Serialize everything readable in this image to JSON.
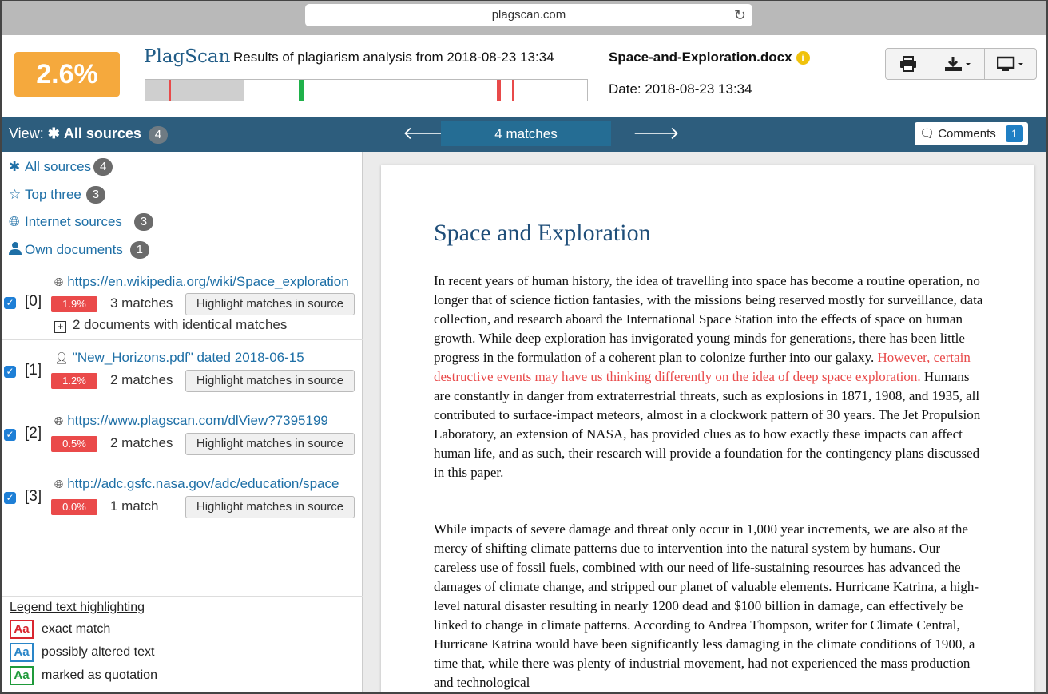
{
  "browser": {
    "url": "plagscan.com"
  },
  "header": {
    "score": "2.6%",
    "logo": "PlagScan",
    "analysis_title": "Results of plagiarism analysis from 2018-08-23 13:34",
    "doc_name": "Space-and-Exploration.docx",
    "doc_date": "Date: 2018-08-23 13:34",
    "colors": {
      "score": "#f5a93d",
      "brand": "#1f5b86",
      "bar_red": "#e84a4a",
      "bar_green": "#1fb14a"
    }
  },
  "toolbar": {
    "view_prefix": "View:",
    "view_value": "All sources",
    "view_count": "4",
    "matches": "4 matches",
    "comments_label": "Comments",
    "comments_count": "1"
  },
  "filters": [
    {
      "label": "All sources",
      "count": "4",
      "icon": "asterisk-icon"
    },
    {
      "label": "Top three",
      "count": "3",
      "icon": "star-icon"
    },
    {
      "label": "Internet sources",
      "count": "3",
      "icon": "globe-icon"
    },
    {
      "label": "Own documents",
      "count": "1",
      "icon": "user-icon"
    }
  ],
  "sources": [
    {
      "index": "[0]",
      "link": "https://en.wikipedia.org/wiki/Space_exploration",
      "percent": "1.9%",
      "matches": "3 matches",
      "button": "Highlight matches in source",
      "extra": "2 documents with identical matches",
      "icon": "globe-icon"
    },
    {
      "index": "[1]",
      "link": "\"New_Horizons.pdf\" dated 2018-06-15",
      "percent": "1.2%",
      "matches": "2 matches",
      "button": "Highlight matches in source",
      "icon": "user-icon"
    },
    {
      "index": "[2]",
      "link": "https://www.plagscan.com/dlView?7395199",
      "percent": "0.5%",
      "matches": "2 matches",
      "button": "Highlight matches in source",
      "icon": "globe-icon"
    },
    {
      "index": "[3]",
      "link": "http://adc.gsfc.nasa.gov/adc/education/space",
      "percent": "0.0%",
      "matches": "1 match",
      "button": "Highlight matches in source",
      "icon": "globe-icon"
    }
  ],
  "legend": {
    "title": "Legend text highlighting",
    "items": [
      {
        "sample": "Aa",
        "label": "exact match",
        "color": "#d9262f"
      },
      {
        "sample": "Aa",
        "label": "possibly altered text",
        "color": "#2a86c8"
      },
      {
        "sample": "Aa",
        "label": "marked as quotation",
        "color": "#1f9a3a"
      }
    ]
  },
  "document": {
    "title": "Space and Exploration",
    "p1_before": "In recent years of human history, the idea of travelling into space has become a routine operation, no longer that of science fiction fantasies, with the missions being reserved mostly for surveillance, data collection, and research aboard the International Space Station into the effects of space on human growth. While deep exploration has invigorated young minds for generations, there has been little progress in the formulation of a coherent plan to colonize further into our galaxy. ",
    "p1_highlight": "However, certain destructive events may have us thinking differently on the idea of deep space exploration.",
    "p1_after": " Humans are constantly in danger from extraterrestrial threats, such as explosions in 1871, 1908, and 1935, all contributed to surface-impact meteors, almost in a clockwork pattern of 30 years. The Jet Propulsion Laboratory, an extension of NASA, has provided clues as to how exactly these impacts can affect human life, and as such, their research will provide a foundation for the contingency plans discussed in this paper.",
    "p2": "While impacts of severe damage and threat only occur in 1,000 year increments, we are also at the mercy of shifting climate patterns due to intervention into the natural system by humans. Our careless use of fossil fuels, combined with our need of life-sustaining resources has advanced the damages of climate change, and stripped our planet of valuable elements. Hurricane Katrina, a high-level natural disaster resulting in nearly 1200 dead and $100 billion in damage, can effectively be linked to change in climate patterns. According to Andrea Thompson, writer for Climate Central, Hurricane Katrina would have been significantly less damaging in the climate conditions of 1900, a time that, while there was plenty of industrial movement, had not experienced the mass production and technological"
  }
}
